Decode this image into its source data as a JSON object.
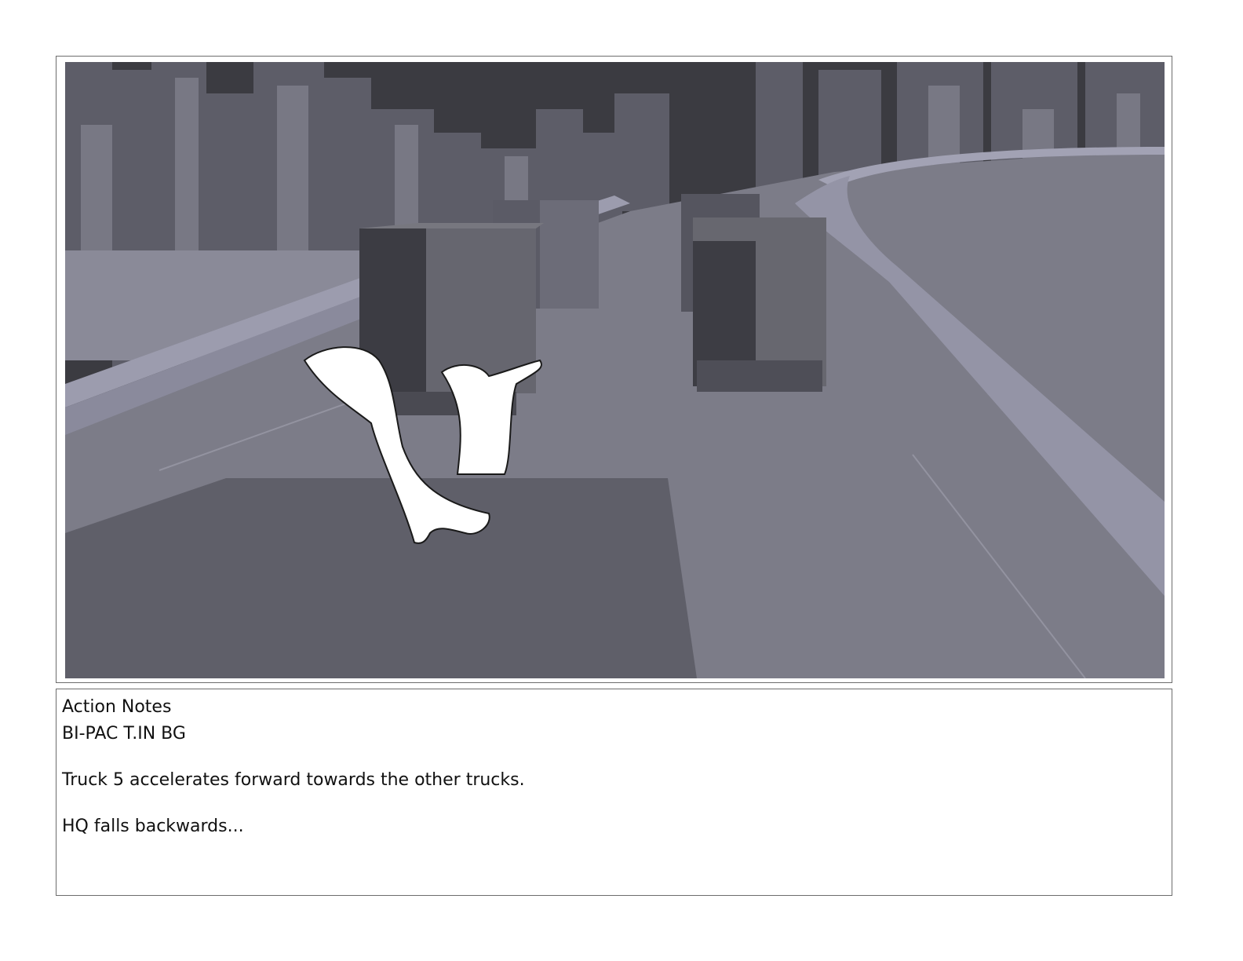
{
  "notes": {
    "heading": "Action Notes",
    "lines": [
      "BI-PAC T.IN BG",
      "Truck 5 accelerates forward towards the other trucks.",
      "HQ falls backwards..."
    ]
  }
}
